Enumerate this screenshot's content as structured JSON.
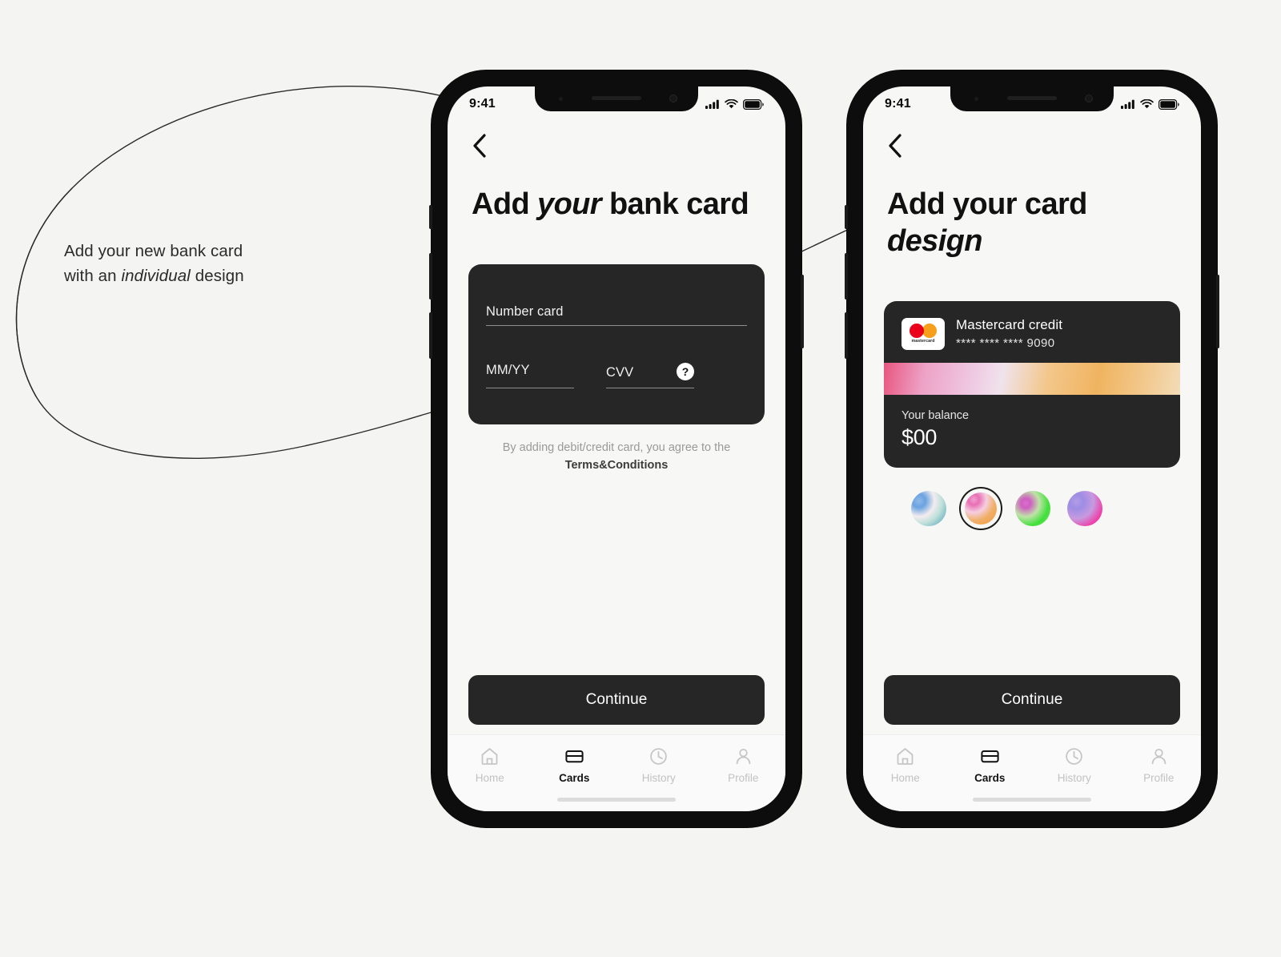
{
  "annotation": {
    "line1": "Add your new bank card",
    "line2_pre": "with an ",
    "line2_em": "individual",
    "line2_post": " design"
  },
  "colors": {
    "page_background": "#f4f4f3",
    "screen_background": "#f7f7f6",
    "card_dark": "#262626",
    "accent_text": "#111111",
    "muted_text": "#9a9a9a",
    "mastercard_red": "#eb001b",
    "mastercard_orange": "#f79e1b"
  },
  "phone1": {
    "status": {
      "time": "9:41",
      "signal_icon": "signal-bars-icon",
      "wifi_icon": "wifi-icon",
      "battery_icon": "battery-icon"
    },
    "back_icon": "chevron-left-icon",
    "title": {
      "pre": "Add ",
      "em": "your",
      "post": " bank card"
    },
    "form": {
      "number_placeholder": "Number card",
      "expiry_placeholder": "MM/YY",
      "cvv_placeholder": "CVV",
      "help_label": "?"
    },
    "terms": {
      "text": "By adding debit/credit card, you agree to the ",
      "link": "Terms&Conditions"
    },
    "continue_label": "Continue",
    "tabs": [
      {
        "label": "Home",
        "icon": "home-icon",
        "active": false
      },
      {
        "label": "Cards",
        "icon": "card-icon",
        "active": true
      },
      {
        "label": "History",
        "icon": "clock-icon",
        "active": false
      },
      {
        "label": "Profile",
        "icon": "person-icon",
        "active": false
      }
    ]
  },
  "phone2": {
    "status": {
      "time": "9:41",
      "signal_icon": "signal-bars-icon",
      "wifi_icon": "wifi-icon",
      "battery_icon": "battery-icon"
    },
    "back_icon": "chevron-left-icon",
    "title": {
      "pre": "Add your card ",
      "em": "design",
      "post": ""
    },
    "card": {
      "brand_logo": "mastercard-logo",
      "brand_word": "mastercard",
      "name": "Mastercard credit",
      "number_masked": "**** **** **** 9090",
      "balance_label": "Your balance",
      "balance_amount": "$00"
    },
    "designs": [
      {
        "name": "design-blue-teal",
        "selected": false,
        "gradient": "radial-gradient(circle at 22% 28%, #8fb8ea 0%, #6aa3e0 18%, #f3ecef 42%, #bfe0da 62%, #74b6c4 85%, #5b9fd6 100%)"
      },
      {
        "name": "design-pink-orange",
        "selected": true,
        "gradient": "radial-gradient(circle at 28% 22%, #f0a0d0 0%, #e86fb5 16%, #f5cfe0 38%, #f0b06a 62%, #f2a24f 82%, #ef7e72 100%)"
      },
      {
        "name": "design-green-magenta",
        "selected": false,
        "gradient": "radial-gradient(circle at 30% 35%, #d86fd0 0%, #cf5fc0 14%, #bfe3a8 40%, #3fe03a 68%, #6adf55 88%, #a8e88f 100%)"
      },
      {
        "name": "design-purple-magenta",
        "selected": false,
        "gradient": "radial-gradient(circle at 26% 30%, #b49ce8 0%, #9d8de4 20%, #c79ae0 48%, #ef3fa8 76%, #e24fb4 100%)"
      }
    ],
    "card_stripe_gradient": "linear-gradient(100deg, #e8557f 0%, #eda2c6 14%, #efc8e2 30%, #f0e3ec 40%, #f3c78c 55%, #f0b460 72%, #f2c98f 88%, #f3dcb8 100%)",
    "continue_label": "Continue",
    "tabs": [
      {
        "label": "Home",
        "icon": "home-icon",
        "active": false
      },
      {
        "label": "Cards",
        "icon": "card-icon",
        "active": true
      },
      {
        "label": "History",
        "icon": "clock-icon",
        "active": false
      },
      {
        "label": "Profile",
        "icon": "person-icon",
        "active": false
      }
    ]
  }
}
